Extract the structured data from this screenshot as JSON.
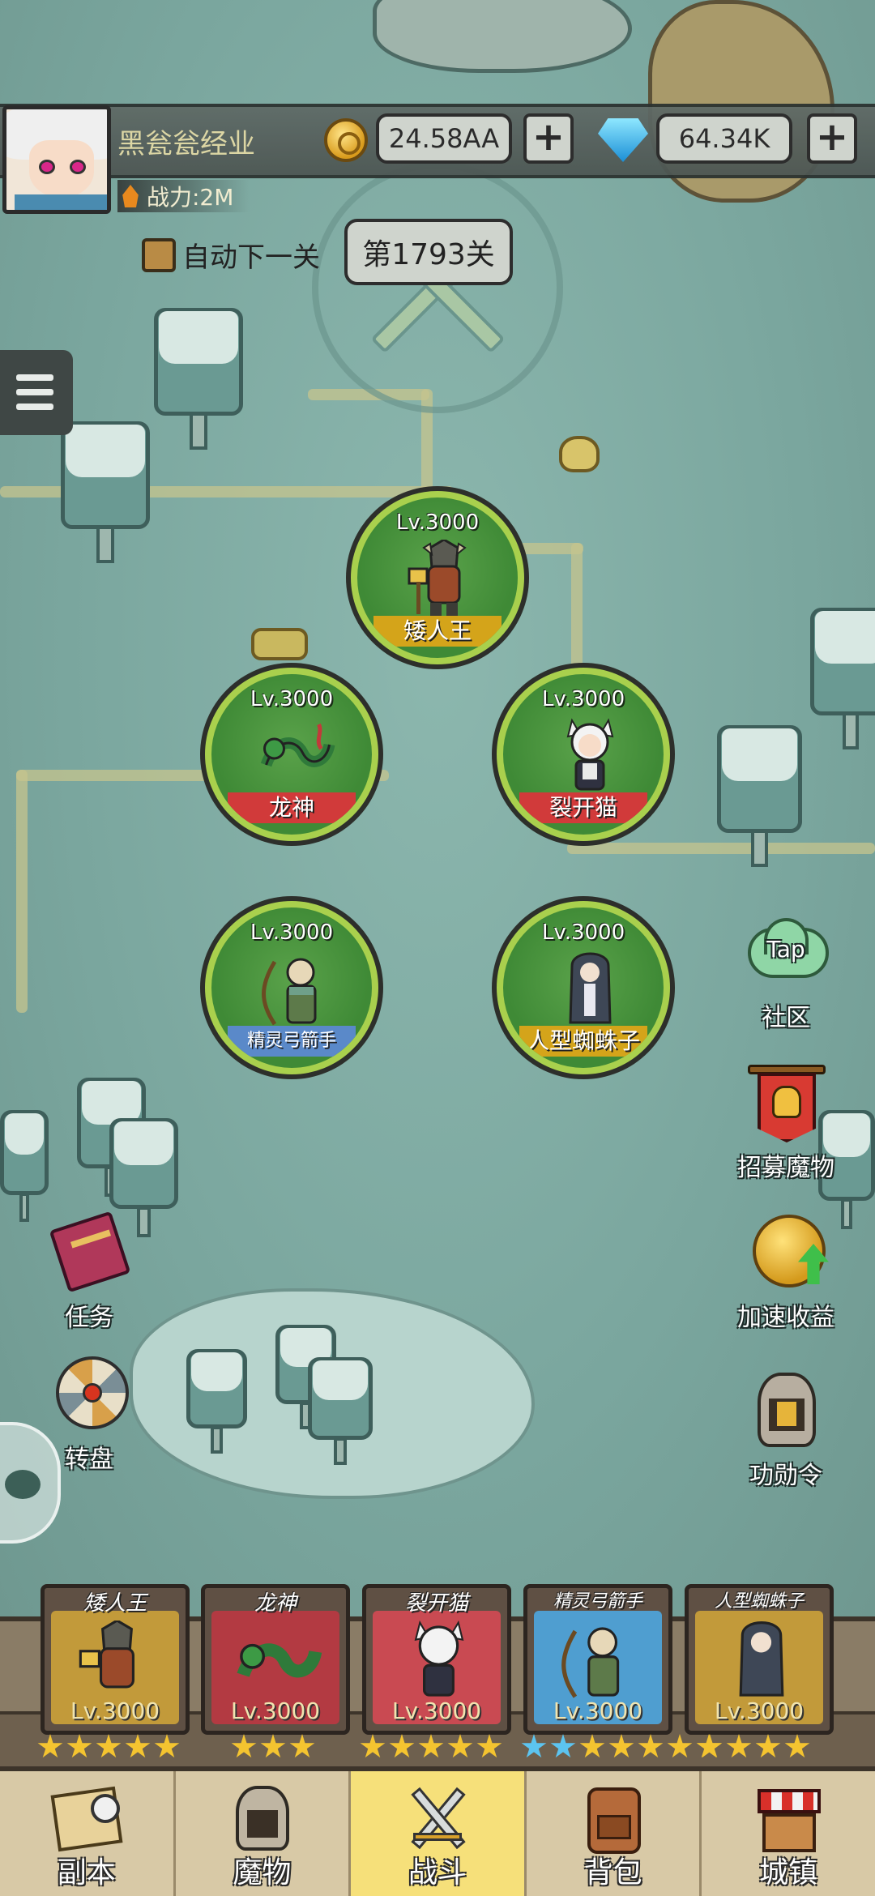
{
  "header": {
    "player_name": "黑瓮瓮经业",
    "power_label": "战力:2M",
    "coins": "24.58AA",
    "gems": "64.34K",
    "plus": "+"
  },
  "stage": {
    "auto_next_label": "自动下一关",
    "current_stage": "第1793关"
  },
  "heroes": [
    {
      "level": "Lv.3000",
      "name": "矮人王"
    },
    {
      "level": "Lv.3000",
      "name": "龙神"
    },
    {
      "level": "Lv.3000",
      "name": "裂开猫"
    },
    {
      "level": "Lv.3000",
      "name": "精灵弓箭手"
    },
    {
      "level": "Lv.3000",
      "name": "人型蜘蛛子"
    }
  ],
  "side_buttons": {
    "community": "社区",
    "community_tap": "Tap",
    "recruit": "招募魔物",
    "speed_income": "加速收益",
    "merit": "功勋令",
    "tasks": "任务",
    "wheel": "转盘"
  },
  "team": [
    {
      "name": "矮人王",
      "level": "Lv.3000",
      "stars": 5,
      "blue_stars": 0
    },
    {
      "name": "龙神",
      "level": "Lv.3000",
      "stars": 3,
      "blue_stars": 0
    },
    {
      "name": "裂开猫",
      "level": "Lv.3000",
      "stars": 5,
      "blue_stars": 0
    },
    {
      "name": "精灵弓箭手",
      "level": "Lv.3000",
      "stars": 5,
      "blue_stars": 2
    },
    {
      "name": "人型蜘蛛子",
      "level": "Lv.3000",
      "stars": 4,
      "blue_stars": 0
    }
  ],
  "nav": [
    {
      "label": "副本",
      "icon": "map-scroll-icon"
    },
    {
      "label": "魔物",
      "icon": "helmet-icon"
    },
    {
      "label": "战斗",
      "icon": "crossed-swords-icon",
      "active": true
    },
    {
      "label": "背包",
      "icon": "backpack-icon"
    },
    {
      "label": "城镇",
      "icon": "shop-icon"
    }
  ],
  "colors": {
    "map_bg": "#7fa9a1",
    "hero_ring": "#a9d04d",
    "nav_active": "#f6e07a"
  }
}
